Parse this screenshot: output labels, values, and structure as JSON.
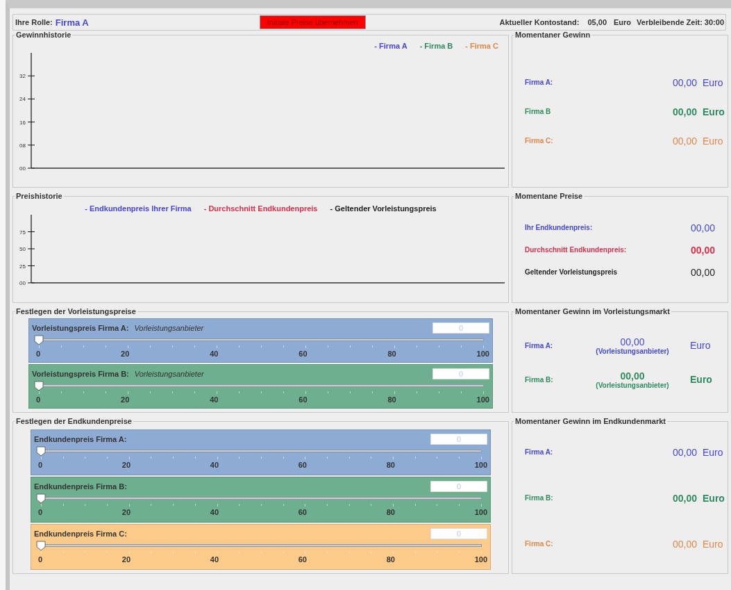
{
  "header": {
    "role_label": "Ihre Rolle:",
    "role": "Firma A",
    "button": "Initiale Preise übernehmen",
    "balance_label": "Aktueller Kontostand:",
    "balance": "05,00",
    "balance_unit": "Euro",
    "time": "Verbleibende Zeit: 30:00"
  },
  "profit_history": {
    "title": "Gewinnhistorie",
    "chart_data": {
      "type": "line",
      "ylim": [
        0,
        40
      ],
      "yticks": [
        {
          "value": 0,
          "label": "00"
        },
        {
          "value": 8,
          "label": "08"
        },
        {
          "value": 16,
          "label": "16"
        },
        {
          "value": 24,
          "label": "24"
        },
        {
          "value": 32,
          "label": "32"
        }
      ],
      "series": [
        {
          "name": "- Firma A",
          "color": "#4646d8"
        },
        {
          "name": "- Firma B",
          "color": "#2e8b60"
        },
        {
          "name": "- Firma C",
          "color": "#e0884a"
        }
      ]
    }
  },
  "price_history": {
    "title": "Preishistorie",
    "chart_data": {
      "type": "line",
      "ylim": [
        0,
        100
      ],
      "yticks": [
        {
          "value": 0,
          "label": "00"
        },
        {
          "value": 25,
          "label": "25"
        },
        {
          "value": 50,
          "label": "50"
        },
        {
          "value": 75,
          "label": "75"
        }
      ],
      "series": [
        {
          "name": "- Endkundenpreis Ihrer Firma",
          "color": "#4646d8"
        },
        {
          "name": "- Durchschnitt Endkundenpreis",
          "color": "#d8304a"
        },
        {
          "name": "- Geltender Vorleistungspreis",
          "color": "#222222"
        }
      ]
    }
  },
  "wholesale_prices": {
    "title": "Festlegen der Vorleistungspreise",
    "sliders": [
      {
        "label": "Vorleistungspreis Firma A:",
        "role": "Vorleistungsanbieter",
        "value": "0",
        "level": 0,
        "color": "#8eabd3",
        "ticks": [
          "0",
          "20",
          "40",
          "60",
          "80",
          "100"
        ]
      },
      {
        "label": "Vorleistungspreis Firma B:",
        "role": "Vorleistungsanbieter",
        "value": "0",
        "level": 0,
        "color": "#6daf8e",
        "ticks": [
          "0",
          "20",
          "40",
          "60",
          "80",
          "100"
        ]
      }
    ]
  },
  "retail_prices": {
    "title": "Festlegen der Endkundenpreise",
    "sliders": [
      {
        "label": "Endkundenpreis Firma A:",
        "value": "0",
        "level": 0,
        "color": "#8eabd3",
        "ticks": [
          "0",
          "20",
          "40",
          "60",
          "80",
          "100"
        ]
      },
      {
        "label": "Endkundenpreis Firma B:",
        "value": "0",
        "level": 0,
        "color": "#6daf8e",
        "ticks": [
          "0",
          "20",
          "40",
          "60",
          "80",
          "100"
        ]
      },
      {
        "label": "Endkundenpreis Firma C:",
        "value": "0",
        "level": 0,
        "color": "#fccb8a",
        "ticks": [
          "0",
          "20",
          "40",
          "60",
          "80",
          "100"
        ]
      }
    ]
  },
  "current_profit": {
    "title": "Momentaner Gewinn",
    "rows": [
      {
        "label": "Firma A:",
        "value": "00,00",
        "unit": "Euro",
        "color": "#4646d8"
      },
      {
        "label": "Firma B",
        "value": "00,00",
        "unit": "Euro",
        "color": "#2e8b60"
      },
      {
        "label": "Firma C:",
        "value": "00,00",
        "unit": "Euro",
        "color": "#e0884a"
      }
    ]
  },
  "current_prices": {
    "title": "Momentane Preise",
    "rows": [
      {
        "label": "Ihr Endkundenpreis:",
        "value": "00,00",
        "color": "#4646d8"
      },
      {
        "label": "Durchschnitt Endkundenpreis:",
        "value": "00,00",
        "color": "#d8304a"
      },
      {
        "label": "Geltender Vorleistungspreis",
        "value": "00,00",
        "color": "#222222"
      }
    ]
  },
  "wholesale_profit": {
    "title": "Momentaner Gewinn im Vorleistungsmarkt",
    "rows": [
      {
        "label": "Firma A:",
        "value": "00,00",
        "note": "(Vorleistungsanbieter)",
        "unit": "Euro",
        "color": "#4646d8"
      },
      {
        "label": "Firma B:",
        "value": "00,00",
        "note": "(Vorleistungsanbieter)",
        "unit": "Euro",
        "color": "#2e8b60"
      }
    ]
  },
  "retail_profit": {
    "title": "Momentaner Gewinn im Endkundenmarkt",
    "rows": [
      {
        "label": "Firma A:",
        "value": "00,00",
        "unit": "Euro",
        "color": "#4646d8"
      },
      {
        "label": "Firma B:",
        "value": "00,00",
        "unit": "Euro",
        "color": "#2e8b60"
      },
      {
        "label": "Firma C:",
        "value": "00,00",
        "unit": "Euro",
        "color": "#e0884a"
      }
    ]
  }
}
